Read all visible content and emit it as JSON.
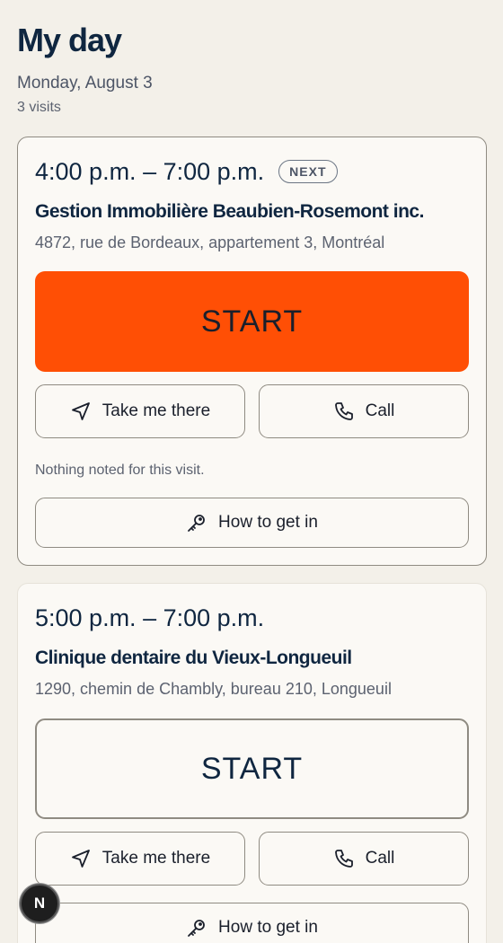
{
  "header": {
    "title": "My day",
    "date": "Monday, August 3",
    "count": "3 visits"
  },
  "visits": [
    {
      "time": "4:00 p.m. – 7:00 p.m.",
      "badge": "NEXT",
      "client": "Gestion Immobilière Beaubien-Rosemont inc.",
      "address": "4872, rue de Bordeaux, appartement 3, Montréal",
      "start_label": "START",
      "directions_label": "Take me there",
      "call_label": "Call",
      "note": "Nothing noted for this visit.",
      "access_label": "How to get in"
    },
    {
      "time": "5:00 p.m. – 7:00 p.m.",
      "client": "Clinique dentaire du Vieux-Longueuil",
      "address": "1290, chemin de Chambly, bureau 210, Longueuil",
      "start_label": "START",
      "directions_label": "Take me there",
      "call_label": "Call",
      "access_label": "How to get in"
    }
  ],
  "fab": {
    "label": "N"
  },
  "colors": {
    "background": "#f3f0e9",
    "card": "#fbf9f5",
    "primary_start": "#ff4f05",
    "heading": "#0f2640",
    "muted": "#5c6270",
    "border": "#8f8b82"
  },
  "icons": {
    "directions": "navigation-arrow-icon",
    "call": "phone-icon",
    "access": "key-icon"
  }
}
